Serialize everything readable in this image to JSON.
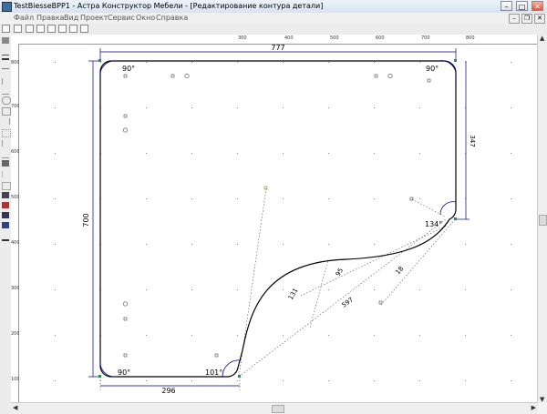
{
  "window": {
    "title": "TestBiesseBPP1 - Астра Конструктор Мебели - [Редактирование контура детали]",
    "minimize_glyph": "–",
    "maximize_glyph": "□",
    "close_glyph": "✕"
  },
  "menu": {
    "items": [
      "Файл",
      "Правка",
      "Вид",
      "Проект",
      "Сервис",
      "Окно",
      "Справка"
    ]
  },
  "ruler": {
    "h_ticks": [
      "300",
      "400",
      "500",
      "600",
      "700",
      "800"
    ],
    "v_ticks": [
      "800",
      "700",
      "600",
      "500",
      "400",
      "300",
      "200",
      "100"
    ]
  },
  "drawing": {
    "dims": {
      "top_width": "777",
      "left_height": "700",
      "right_height": "347",
      "bottom_width": "296",
      "arc_radius": "131",
      "diag_length": "597",
      "small_radius": "95",
      "dim_18": "18"
    },
    "angles": {
      "top_left": "90°",
      "top_right": "90°",
      "bottom_left": "90°",
      "bottom_right": "101°",
      "right_corner": "134°"
    },
    "colors": {
      "contour": "#000000",
      "dimension": "#000080",
      "node": "#2e8b57",
      "helper": "#555555"
    }
  }
}
